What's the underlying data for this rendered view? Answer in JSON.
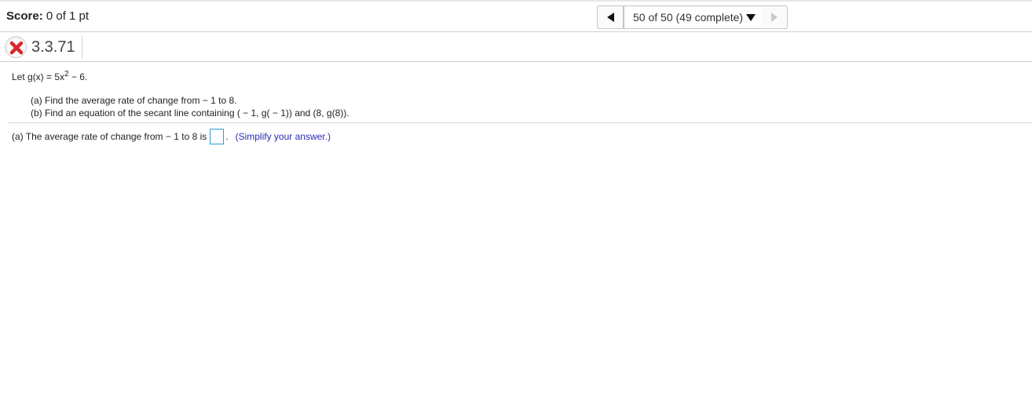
{
  "score": {
    "label": "Score:",
    "value": "0 of 1 pt"
  },
  "nav": {
    "prev_icon": "triangle-left-icon",
    "progress": "50 of 50 (49 complete)",
    "dropdown_icon": "caret-down-icon",
    "next_icon": "triangle-right-icon"
  },
  "question": {
    "status_icon": "incorrect-x-icon",
    "number": "3.3.71"
  },
  "problem": {
    "intro_prefix": "Let g(x) = 5x",
    "exponent": "2",
    "intro_suffix": " − 6.",
    "part_a": "(a)  Find the average rate of change from  − 1 to 8.",
    "part_b": "(b)  Find an equation of the secant line containing ( − 1, g( − 1)) and (8, g(8))."
  },
  "answer": {
    "prompt": "(a)  The average rate of change from  − 1 to 8 is",
    "value": "",
    "period": ".",
    "hint": "(Simplify your answer.)"
  },
  "colors": {
    "input_border": "#2a9fd6",
    "hint": "#2b2bb5",
    "incorrect": "#d9262c"
  }
}
